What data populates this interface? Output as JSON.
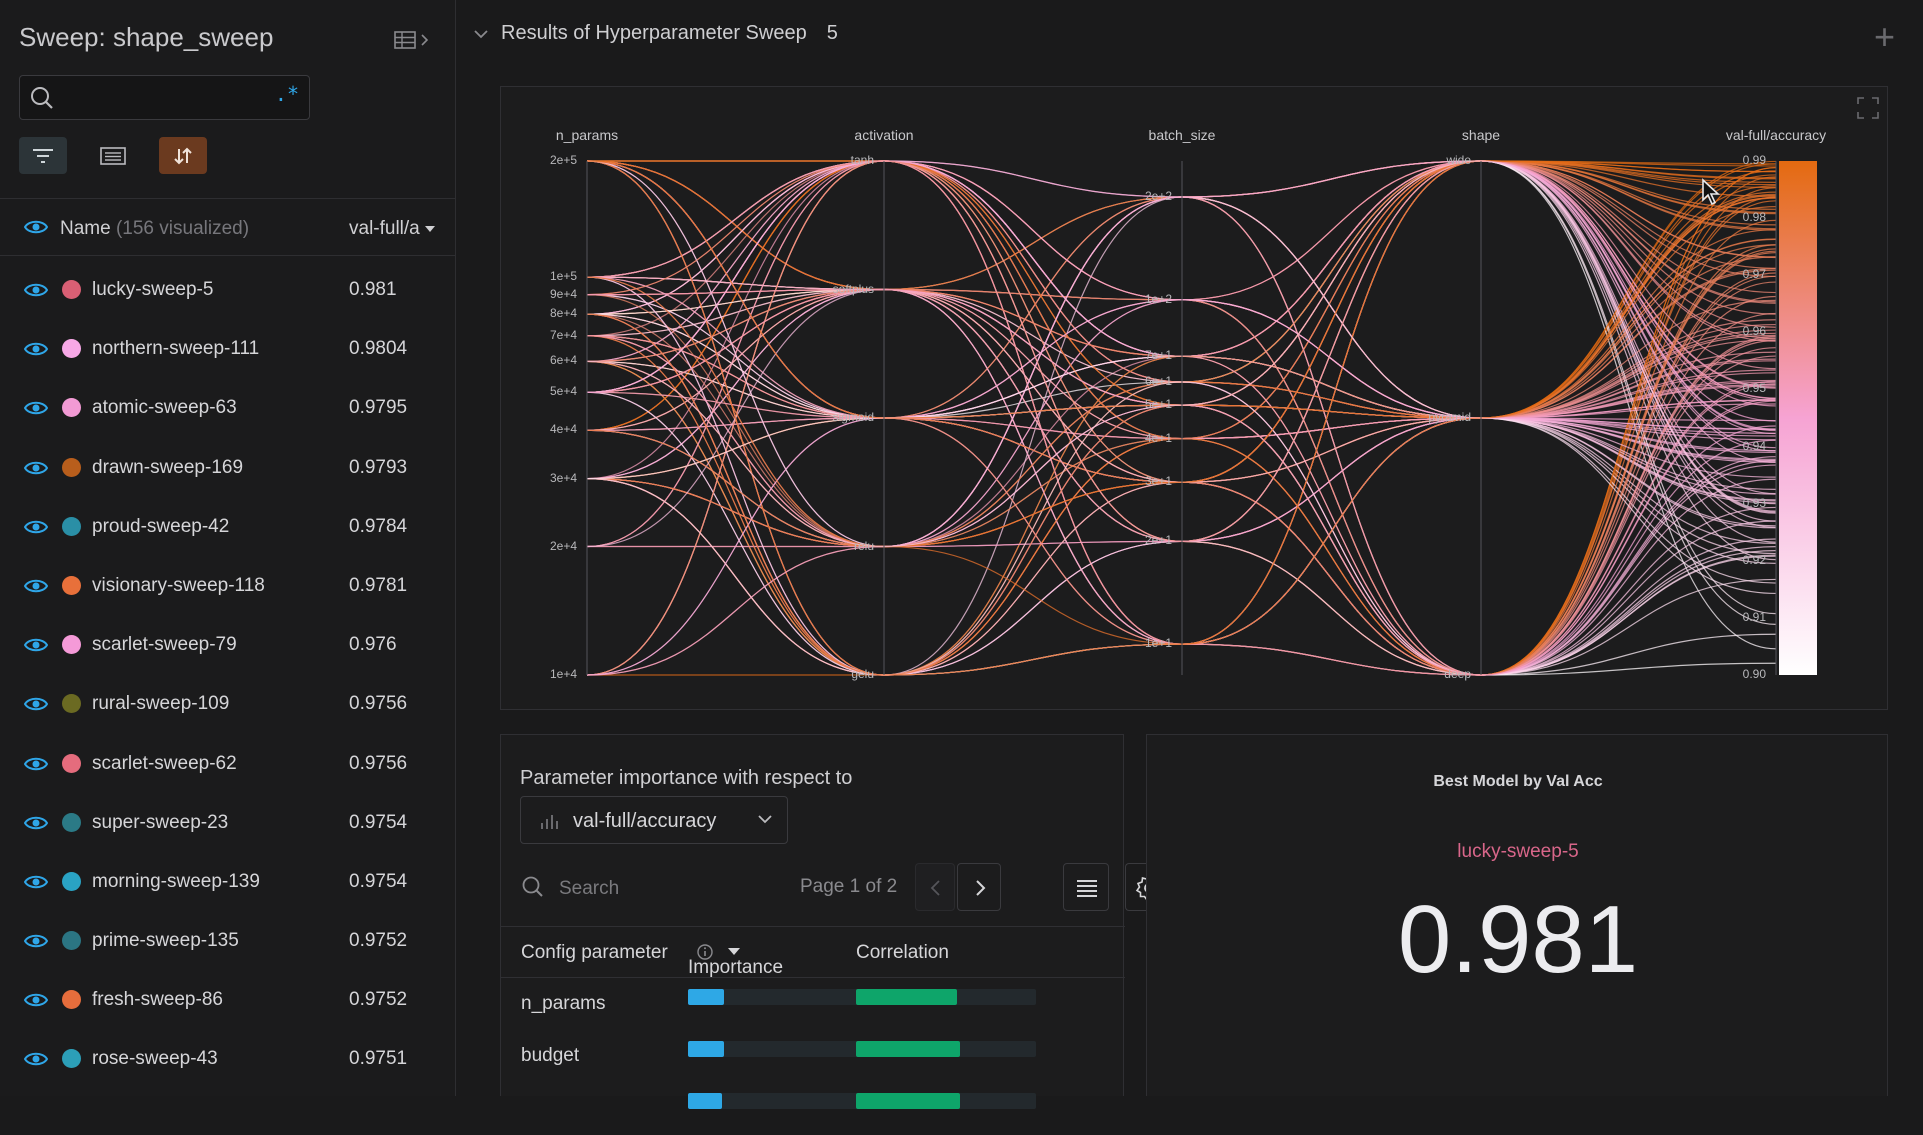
{
  "sidebar": {
    "title": "Sweep: shape_sweep",
    "search_placeholder": "",
    "header": {
      "name": "Name",
      "visualized": "(156 visualized)",
      "column": "val-full/a"
    },
    "runs": [
      {
        "name": "lucky-sweep-5",
        "value": "0.981",
        "color": "#d95f74"
      },
      {
        "name": "northern-sweep-111",
        "value": "0.9804",
        "color": "#f7a8e6"
      },
      {
        "name": "atomic-sweep-63",
        "value": "0.9795",
        "color": "#f29ad4"
      },
      {
        "name": "drawn-sweep-169",
        "value": "0.9793",
        "color": "#b85e1c"
      },
      {
        "name": "proud-sweep-42",
        "value": "0.9784",
        "color": "#2a8fa6"
      },
      {
        "name": "visionary-sweep-118",
        "value": "0.9781",
        "color": "#e8703a"
      },
      {
        "name": "scarlet-sweep-79",
        "value": "0.976",
        "color": "#f59ad8"
      },
      {
        "name": "rural-sweep-109",
        "value": "0.9756",
        "color": "#6b6a22"
      },
      {
        "name": "scarlet-sweep-62",
        "value": "0.9756",
        "color": "#e56c7d"
      },
      {
        "name": "super-sweep-23",
        "value": "0.9754",
        "color": "#2b7a86"
      },
      {
        "name": "morning-sweep-139",
        "value": "0.9754",
        "color": "#2aa3c4"
      },
      {
        "name": "prime-sweep-135",
        "value": "0.9752",
        "color": "#2b7583"
      },
      {
        "name": "fresh-sweep-86",
        "value": "0.9752",
        "color": "#e66d3c"
      },
      {
        "name": "rose-sweep-43",
        "value": "0.9751",
        "color": "#2c9fb8"
      }
    ]
  },
  "section": {
    "title": "Results of Hyperparameter Sweep",
    "count": "5"
  },
  "chart_data": {
    "type": "parallel-coordinates",
    "axes": [
      {
        "name": "n_params",
        "ticks": [
          "2e+5",
          "1e+5",
          "9e+4",
          "8e+4",
          "7e+4",
          "6e+4",
          "5e+4",
          "4e+4",
          "3e+4",
          "2e+4",
          "1e+4"
        ]
      },
      {
        "name": "activation",
        "ticks": [
          "tanh",
          "softplus",
          "sigmoid",
          "relu",
          "gelu"
        ]
      },
      {
        "name": "batch_size",
        "ticks": [
          "2e+2",
          "1e+2",
          "7e+1",
          "6e+1",
          "5e+1",
          "4e+1",
          "3e+1",
          "2e+1",
          "1e+1"
        ]
      },
      {
        "name": "shape",
        "ticks": [
          "wide",
          "pyramid",
          "deep"
        ]
      },
      {
        "name": "val-full/accuracy",
        "ticks": [
          "0.99",
          "0.98",
          "0.97",
          "0.96",
          "0.95",
          "0.94",
          "0.93",
          "0.92",
          "0.91",
          "0.90"
        ]
      }
    ],
    "colors": {
      "low": "#ffffff",
      "mid": "#f6a3d3",
      "high": "#e46a10"
    }
  },
  "importance": {
    "title": "Parameter importance with respect to",
    "metric": "val-full/accuracy",
    "search_placeholder": "Search",
    "page": "Page 1 of 2",
    "headers": {
      "param": "Config parameter",
      "importance": "Importance",
      "correlation": "Correlation"
    },
    "rows": [
      {
        "param": "n_params",
        "importance": 0.2,
        "correlation": 0.56
      },
      {
        "param": "budget",
        "importance": 0.2,
        "correlation": 0.58
      },
      {
        "param": "",
        "importance": 0.19,
        "correlation": 0.58
      }
    ],
    "colors": {
      "importance": "#2ea8e6",
      "correlation": "#0ea56a"
    }
  },
  "best_model": {
    "title": "Best Model by Val Acc",
    "run": "lucky-sweep-5",
    "value": "0.981"
  }
}
